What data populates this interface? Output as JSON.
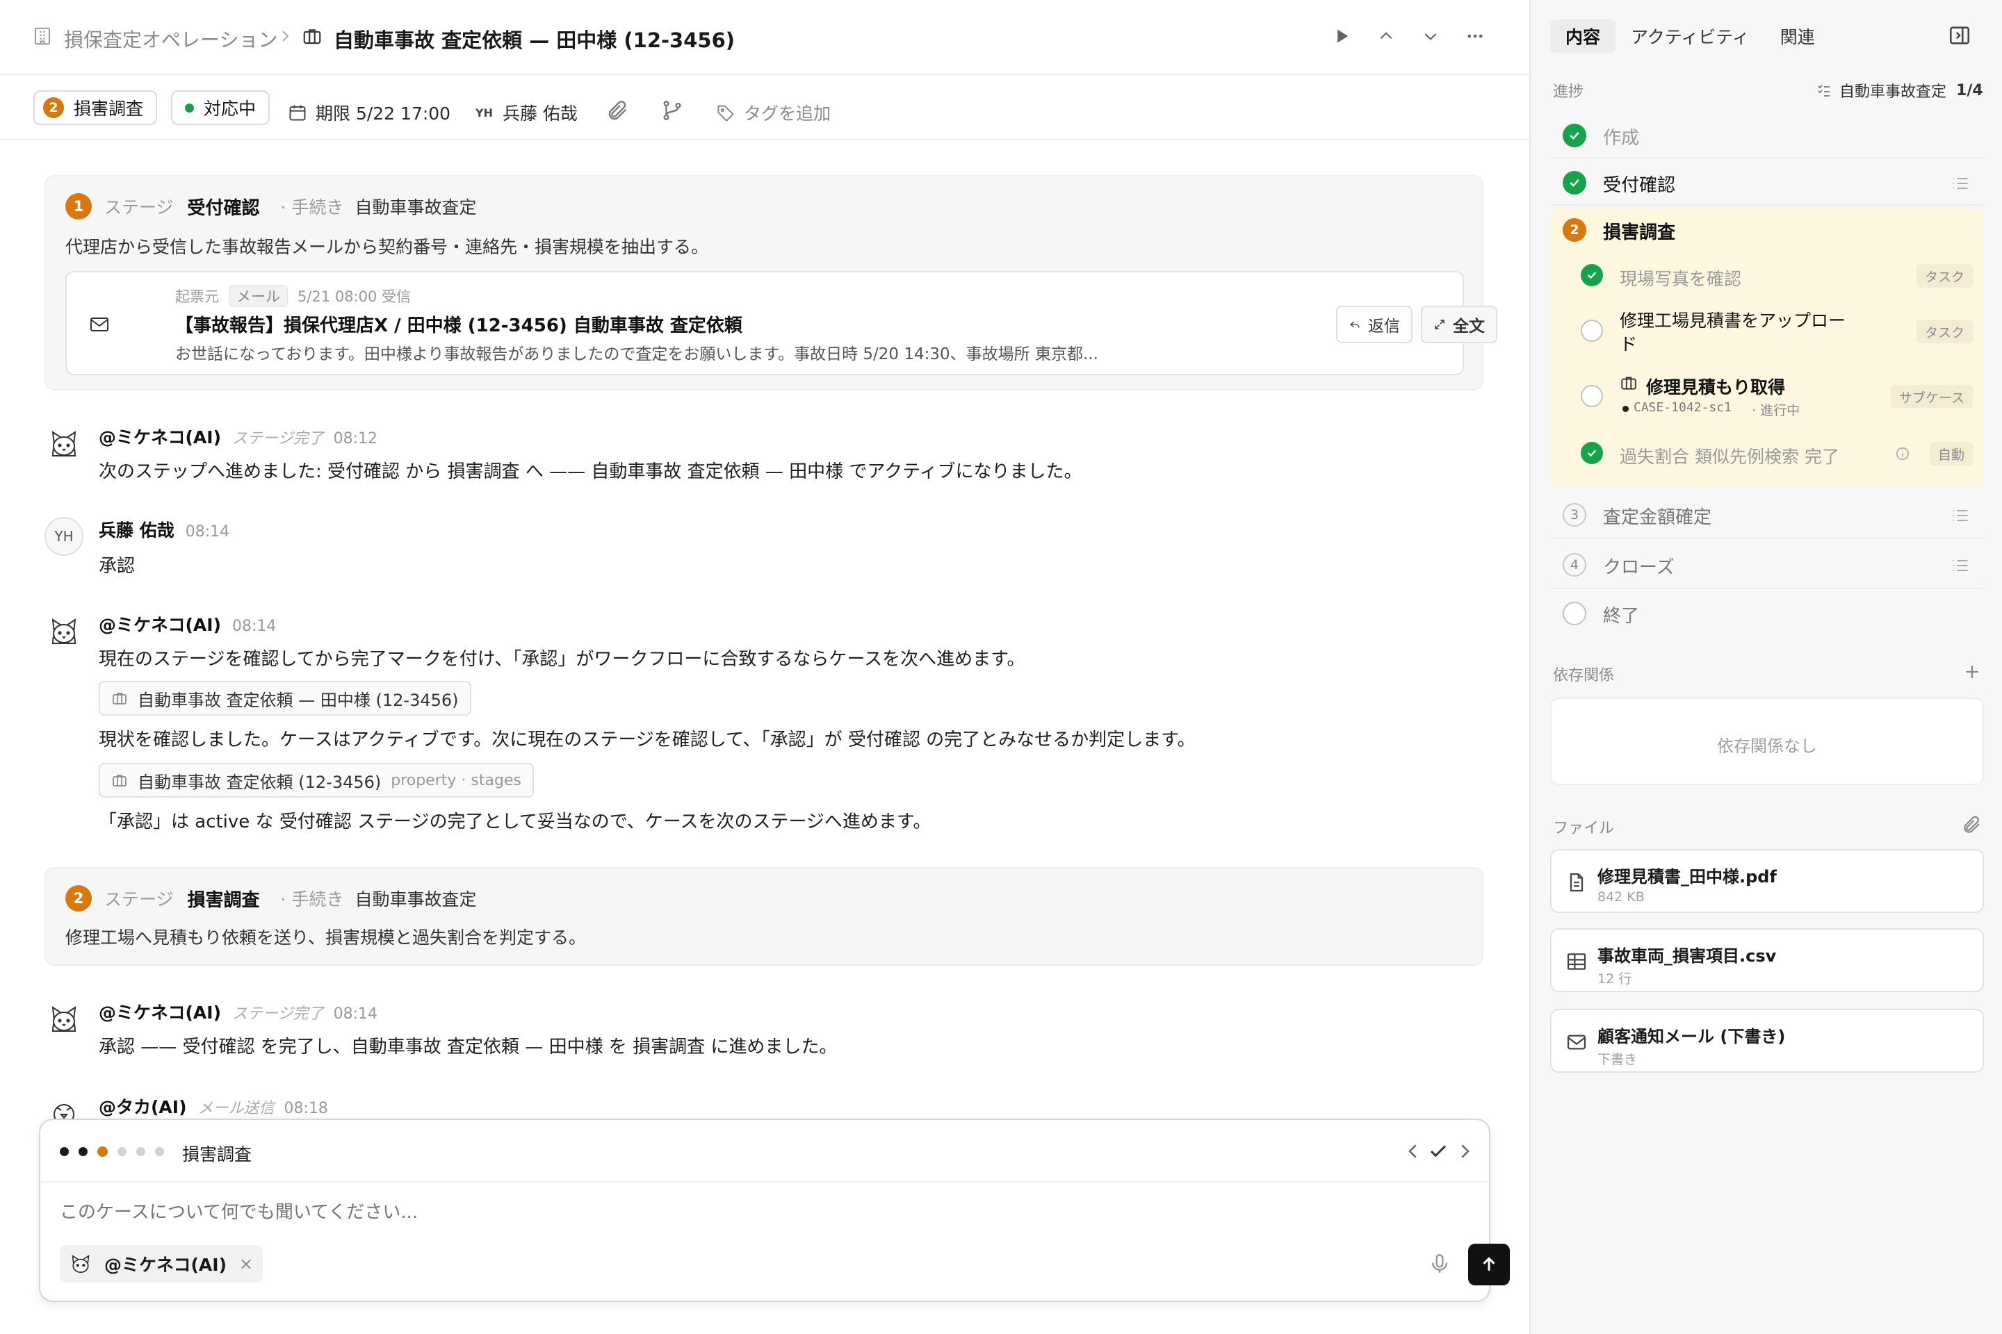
{
  "header": {
    "breadcrumb_root": "損保査定オペレーション",
    "case_title": "自動車事故 査定依頼 — 田中様 (12-3456)"
  },
  "toolbar": {
    "stage_num": "2",
    "stage_label": "損害調査",
    "status_label": "対応中",
    "due_label": "期限 5/22 17:00",
    "assignee_initials": "YH",
    "assignee_name": "兵藤 佑哉",
    "tag_label": "タグを追加"
  },
  "stage1": {
    "num": "1",
    "stage_word": "ステージ",
    "name": "受付確認",
    "proc_word": "· 手続き",
    "proc_name": "自動車事故査定",
    "desc": "代理店から受信した事故報告メールから契約番号・連絡先・損害規模を抽出する。",
    "email": {
      "origin": "起票元",
      "kind": "メール",
      "received": "5/21 08:00 受信",
      "subject": "【事故報告】損保代理店X / 田中様 (12-3456) 自動車事故 査定依頼",
      "body": "お世話になっております。田中様より事故報告がありましたので査定をお願いします。事故日時 5/20 14:30、事故場所 東京都...",
      "reply": "返信",
      "full": "全文"
    }
  },
  "messages": {
    "m1": {
      "author": "@ミケネコ(AI)",
      "kind": "ステージ完了",
      "time": "08:12",
      "text": "次のステップへ進めました: 受付確認 から 損害調査 へ —— 自動車事故 査定依頼 — 田中様 でアクティブになりました。"
    },
    "m2": {
      "initials": "YH",
      "author": "兵藤 佑哉",
      "time": "08:14",
      "text": "承認"
    },
    "m3": {
      "author": "@ミケネコ(AI)",
      "time": "08:14",
      "line1": "現在のステージを確認してから完了マークを付け、「承認」がワークフローに合致するならケースを次へ進めます。",
      "chip1": "自動車事故 査定依頼 — 田中様 (12-3456)",
      "line2": "現状を確認しました。ケースはアクティブです。次に現在のステージを確認して、「承認」が 受付確認 の完了とみなせるか判定します。",
      "chip2": "自動車事故 査定依頼 (12-3456)",
      "chip2_sub": "property · stages",
      "line3": "「承認」は active な 受付確認 ステージの完了として妥当なので、ケースを次のステージへ進めます。"
    },
    "m4": {
      "author": "@ミケネコ(AI)",
      "kind": "ステージ完了",
      "time": "08:14",
      "text": "承認 —— 受付確認 を完了し、自動車事故 査定依頼 — 田中様 を 損害調査 に進めました。"
    },
    "m5": {
      "author": "@タカ(AI)",
      "kind": "メール送信",
      "time": "08:18"
    }
  },
  "stage2": {
    "num": "2",
    "stage_word": "ステージ",
    "name": "損害調査",
    "proc_word": "· 手続き",
    "proc_name": "自動車事故査定",
    "desc": "修理工場へ見積もり依頼を送り、損害規模と過失割合を判定する。"
  },
  "composer": {
    "stage_name": "損害調査",
    "placeholder": "このケースについて何でも聞いてください...",
    "agent_chip": "@ミケネコ(AI)",
    "remove": "×"
  },
  "side": {
    "tabs": [
      "内容",
      "アクティビティ",
      "関連"
    ],
    "progress_label": "進捗",
    "workflow_name": "自動車事故査定",
    "workflow_count": "1/4",
    "steps": {
      "s1": "作成",
      "s2": "受付確認",
      "s3_num": "2",
      "s3": "損害調査",
      "s4_num": "3",
      "s4": "査定金額確定",
      "s5_num": "4",
      "s5": "クローズ",
      "s6": "終了"
    },
    "subtasks": {
      "t1": "現場写真を確認",
      "t1_tag": "タスク",
      "t2a": "修理工場見積書をアップロー",
      "t2b": "ド",
      "t2_tag": "タスク",
      "t3": "修理見積もり取得",
      "t3_case": "CASE-1042-sc1",
      "t3_status": "· 進行中",
      "t3_tag": "サブケース",
      "t4": "過失割合 類似先例検索 完了",
      "t4_tag": "自動"
    },
    "deps_label": "依存関係",
    "deps_empty": "依存関係なし",
    "files_label": "ファイル",
    "files": [
      {
        "name": "修理見積書_田中様.pdf",
        "sub": "842 KB"
      },
      {
        "name": "事故車両_損害項目.csv",
        "sub": "12 行"
      },
      {
        "name": "顧客通知メール (下書き)",
        "sub": "下書き"
      }
    ]
  },
  "colors": {
    "accent_orange": "#d9780d",
    "success_green": "#16a34a",
    "active_stage_bg": "#fdf7df"
  }
}
